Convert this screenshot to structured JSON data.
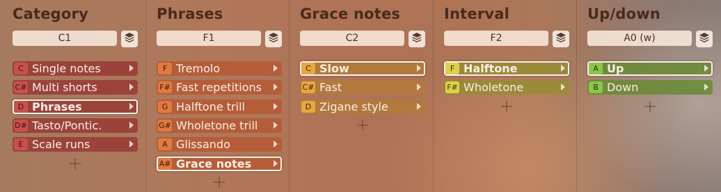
{
  "columns": [
    {
      "title": "Category",
      "note": "C1",
      "theme": "red",
      "items": [
        {
          "key": "C",
          "label": "Single notes",
          "selected": false
        },
        {
          "key": "C#",
          "label": "Multi shorts",
          "selected": false
        },
        {
          "key": "D",
          "label": "Phrases",
          "selected": true
        },
        {
          "key": "D#",
          "label": "Tasto/Pontic.",
          "selected": false
        },
        {
          "key": "E",
          "label": "Scale runs",
          "selected": false
        }
      ]
    },
    {
      "title": "Phrases",
      "note": "F1",
      "theme": "orange",
      "items": [
        {
          "key": "F",
          "label": "Tremolo",
          "selected": false
        },
        {
          "key": "F#",
          "label": "Fast repetitions",
          "selected": false
        },
        {
          "key": "G",
          "label": "Halftone trill",
          "selected": false
        },
        {
          "key": "G#",
          "label": "Wholetone trill",
          "selected": false
        },
        {
          "key": "A",
          "label": "Glissando",
          "selected": false
        },
        {
          "key": "A#",
          "label": "Grace notes",
          "selected": true
        }
      ]
    },
    {
      "title": "Grace notes",
      "note": "C2",
      "theme": "amber",
      "items": [
        {
          "key": "C",
          "label": "Slow",
          "selected": true
        },
        {
          "key": "C#",
          "label": "Fast",
          "selected": false
        },
        {
          "key": "D",
          "label": "Zigane style",
          "selected": false
        }
      ]
    },
    {
      "title": "Interval",
      "note": "F2",
      "theme": "yellow",
      "items": [
        {
          "key": "F",
          "label": "Halftone",
          "selected": true
        },
        {
          "key": "F#",
          "label": "Wholetone",
          "selected": false
        }
      ]
    },
    {
      "title": "Up/down",
      "note": "A0 (w)",
      "theme": "green",
      "items": [
        {
          "key": "A",
          "label": "Up",
          "selected": true
        },
        {
          "key": "B",
          "label": "Down",
          "selected": false
        }
      ]
    }
  ],
  "icons": {
    "layers": "layers-icon",
    "add": "plus-icon",
    "arrow": "chevron-right-icon"
  },
  "colors": {
    "red": "#c85050",
    "orange": "#e07a40",
    "amber": "#e6a642",
    "yellow": "#ddd04a",
    "green": "#8cc44c"
  }
}
